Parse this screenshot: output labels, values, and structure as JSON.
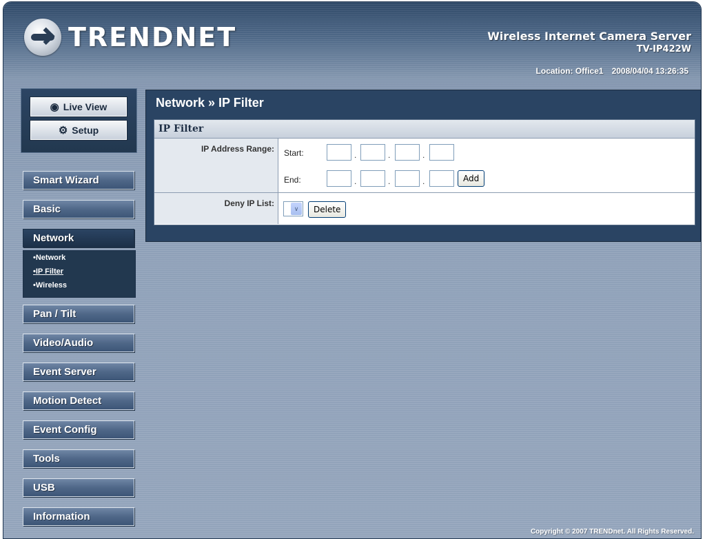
{
  "brand": {
    "logo_text": "TRENDNET",
    "product_name": "Wireless Internet Camera Server",
    "model": "TV-IP422W"
  },
  "status": {
    "location": "Location: Office1",
    "datetime": "2008/04/04 13:26:35"
  },
  "mode_buttons": [
    {
      "label": "Live View",
      "icon": "eye-icon"
    },
    {
      "label": "Setup",
      "icon": "gears-icon"
    }
  ],
  "nav": {
    "items": [
      "Smart Wizard",
      "Basic",
      "Network",
      "Pan / Tilt",
      "Video/Audio",
      "Event Server",
      "Motion Detect",
      "Event Config",
      "Tools",
      "USB",
      "Information"
    ],
    "active": "Network",
    "submenu": [
      "Network",
      "IP Filter",
      "Wireless"
    ],
    "submenu_current": "IP Filter"
  },
  "page": {
    "title": "Network » IP Filter",
    "section": "IP Filter",
    "ip_range_label": "IP Address Range:",
    "start_label": "Start:",
    "end_label": "End:",
    "add_button": "Add",
    "deny_label": "Deny IP List:",
    "delete_button": "Delete",
    "start_values": [
      "",
      "",
      "",
      ""
    ],
    "end_values": [
      "",
      "",
      "",
      ""
    ],
    "deny_selected": ""
  },
  "footer": {
    "copyright": "Copyright © 2007 TRENDnet. All Rights Reserved."
  }
}
